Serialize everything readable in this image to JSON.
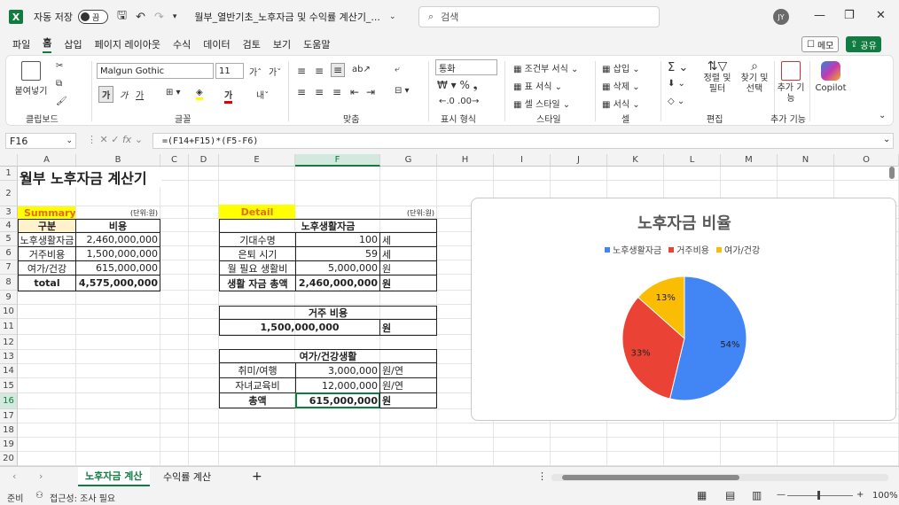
{
  "titlebar": {
    "autosave_label": "자동 저장",
    "autosave_state": "끔",
    "doc_title": "월부_열반기초_노후자금 및 수익률 계산기_...",
    "search_placeholder": "검색",
    "avatar_initials": "JY"
  },
  "menu": {
    "tabs": [
      "파일",
      "홈",
      "삽입",
      "페이지 레이아웃",
      "수식",
      "데이터",
      "검토",
      "보기",
      "도움말"
    ],
    "active": "홈",
    "memo_label": "메모",
    "share_label": "공유"
  },
  "ribbon": {
    "paste_label": "붙여넣기",
    "font_name": "Malgun Gothic",
    "font_size": "11",
    "number_format": "통화",
    "cond_format": "조건부 서식",
    "table_format": "표 서식",
    "cell_style": "셀 스타일",
    "insert": "삽입",
    "delete": "삭제",
    "format": "서식",
    "sort_filter": "정렬 및 필터",
    "find_select": "찾기 및 선택",
    "addins": "추가 기능",
    "copilot": "Copilot",
    "groups": [
      "클립보드",
      "글꼴",
      "맞춤",
      "표시 형식",
      "스타일",
      "셀",
      "편집",
      "추가 기능"
    ]
  },
  "formula_bar": {
    "name_box": "F16",
    "formula": "=(F14+F15)*(F5-F6)"
  },
  "columns": [
    "A",
    "B",
    "C",
    "D",
    "E",
    "F",
    "G",
    "H",
    "I",
    "J",
    "K",
    "L",
    "M",
    "N",
    "O"
  ],
  "rows": [
    "1",
    "2",
    "3",
    "4",
    "5",
    "6",
    "7",
    "8",
    "9",
    "10",
    "11",
    "12",
    "13",
    "14",
    "15",
    "16",
    "17",
    "18",
    "19",
    "20"
  ],
  "sheet": {
    "title": "월부 노후자금 계산기",
    "summary_label": "Summary",
    "unit_left": "(단위:원)",
    "unit_right": "(단위:원)",
    "summary_header": [
      "구분",
      "비용"
    ],
    "summary_rows": [
      {
        "label": "노후생활자금",
        "value": "2,460,000,000"
      },
      {
        "label": "거주비용",
        "value": "1,500,000,000"
      },
      {
        "label": "여가/건강",
        "value": "615,000,000"
      },
      {
        "label": "total",
        "value": "4,575,000,000"
      }
    ],
    "detail_label": "Detail",
    "living_header": "노후생활자금",
    "living_rows": [
      {
        "label": "기대수명",
        "value": "100",
        "unit": "세"
      },
      {
        "label": "은퇴 시기",
        "value": "59",
        "unit": "세"
      },
      {
        "label": "월 필요 생활비",
        "value": "5,000,000",
        "unit": "원"
      },
      {
        "label": "생활 자금 총액",
        "value": "2,460,000,000",
        "unit": "원"
      }
    ],
    "housing_header": "거주 비용",
    "housing_value": "1,500,000,000",
    "housing_unit": "원",
    "leisure_header": "여가/건강생활",
    "leisure_rows": [
      {
        "label": "취미/여행",
        "value": "3,000,000",
        "unit": "원/연"
      },
      {
        "label": "자녀교육비",
        "value": "12,000,000",
        "unit": "원/연"
      },
      {
        "label": "총액",
        "value": "615,000,000",
        "unit": "원"
      }
    ]
  },
  "chart_data": {
    "type": "pie",
    "title": "노후자금 비율",
    "categories": [
      "노후생활자금",
      "거주비용",
      "여가/건강"
    ],
    "values": [
      2460000000,
      1500000000,
      615000000
    ],
    "labels": [
      "54%",
      "33%",
      "13%"
    ],
    "colors": [
      "#4285f4",
      "#ea4335",
      "#fbbc04"
    ],
    "legend": "top"
  },
  "sheet_tabs": [
    "노후자금 계산",
    "수익률 계산"
  ],
  "active_sheet": "노후자금 계산",
  "status": {
    "ready": "준비",
    "accessibility": "접근성: 조사 필요",
    "zoom": "100%"
  }
}
